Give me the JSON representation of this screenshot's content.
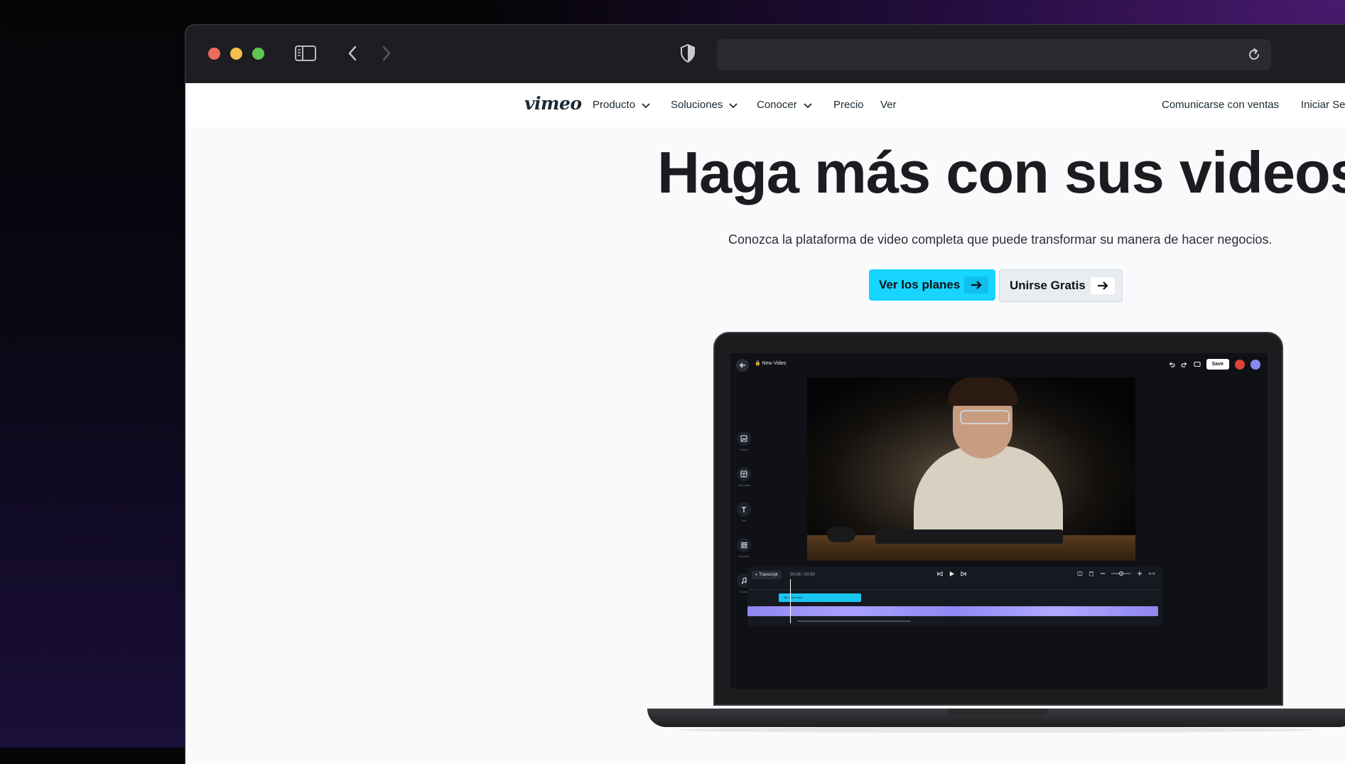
{
  "browser": {
    "url": ""
  },
  "nav": {
    "logo": "vimeo",
    "items": [
      {
        "label": "Producto",
        "has_dropdown": true
      },
      {
        "label": "Soluciones",
        "has_dropdown": true
      },
      {
        "label": "Conocer",
        "has_dropdown": true
      },
      {
        "label": "Precio",
        "has_dropdown": false
      },
      {
        "label": "Ver",
        "has_dropdown": false
      }
    ],
    "contact_sales": "Comunicarse con ventas",
    "sign_in": "Iniciar Ses"
  },
  "hero": {
    "title": "Haga más con sus videos",
    "subtitle": "Conozca la plataforma de video completa que puede transformar su manera de hacer negocios.",
    "primary_button": "Ver los planes",
    "secondary_button": "Unirse Gratis"
  },
  "editor": {
    "project_name": "New Video",
    "save_label": "Save",
    "sidebar": [
      "Media",
      "Templates",
      "Text",
      "Graphics",
      "Audio"
    ],
    "transcript_label": "Transcript",
    "time": "00:06 / 00:50",
    "title_clip": "Title Goes Here"
  },
  "colors": {
    "accent": "#17d5ff",
    "text_dark": "#1a1c1f",
    "timeline_clip": "#a9a1ff"
  }
}
